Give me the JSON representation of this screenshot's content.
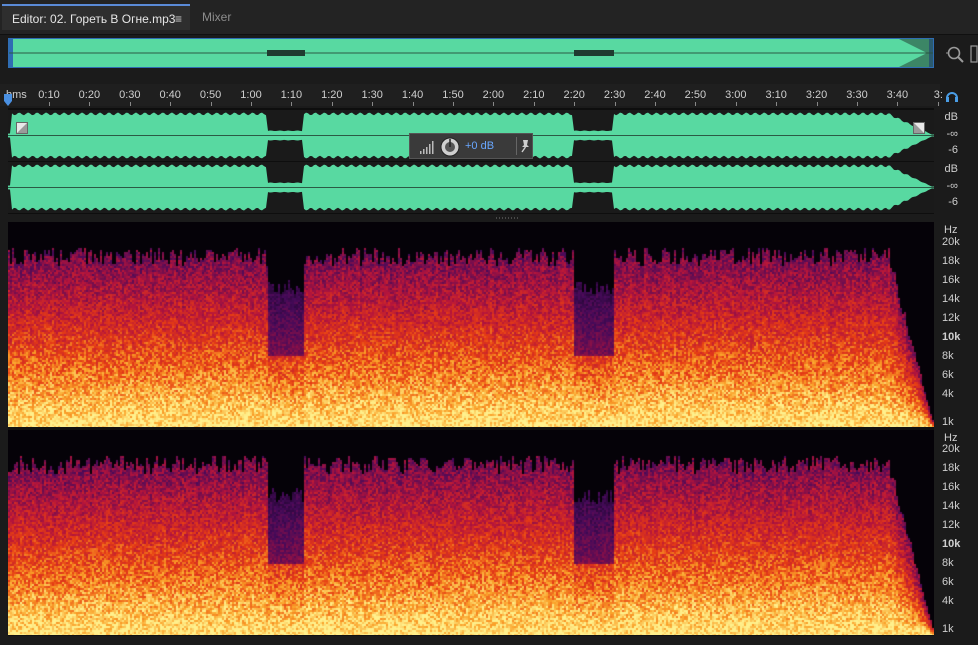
{
  "tabs": [
    {
      "label": "Editor: 02. Гореть В Огне.mp3",
      "menu": "≡"
    },
    {
      "label": "Mixer"
    }
  ],
  "ruler": {
    "unit": "hms",
    "ticks": [
      "0:10",
      "0:20",
      "0:30",
      "0:40",
      "0:50",
      "1:00",
      "1:10",
      "1:20",
      "1:30",
      "1:40",
      "1:50",
      "2:00",
      "2:10",
      "2:20",
      "2:30",
      "2:40",
      "2:50",
      "3:00",
      "3:10",
      "3:20",
      "3:30",
      "3:40",
      "3:"
    ]
  },
  "channels": [
    {
      "db_labels": [
        "dB",
        "-∞",
        "-6"
      ]
    },
    {
      "db_labels": [
        "dB",
        "-∞",
        "-6"
      ]
    }
  ],
  "hud": {
    "gain": "+0 dB"
  },
  "spectral_scale": {
    "unit": "Hz",
    "labels": [
      "20k",
      "18k",
      "16k",
      "14k",
      "12k",
      "10k",
      "8k",
      "6k",
      "4k",
      "1k"
    ]
  },
  "colors": {
    "waveform": "#58d9a1",
    "accent": "#2f6db3",
    "hud_value": "#69a7ff"
  },
  "icons": [
    "menu-icon",
    "zoom-icon",
    "playhead-icon",
    "headphones-icon",
    "level-bars-icon",
    "gain-knob-icon",
    "pin-icon"
  ]
}
